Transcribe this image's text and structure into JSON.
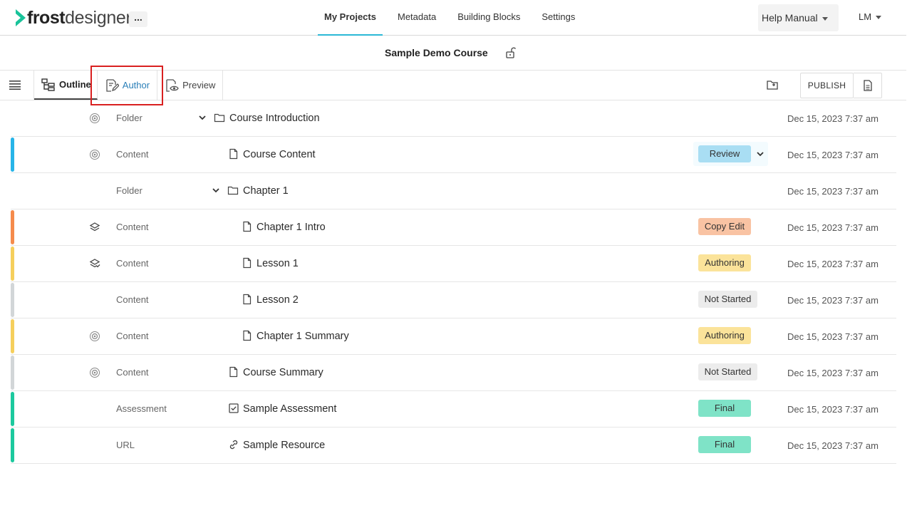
{
  "brand": {
    "name_bold": "frost",
    "name_light": "designer",
    "accent": "#19c39a"
  },
  "header": {
    "more_label": "...",
    "nav": [
      {
        "label": "My Projects",
        "active": true
      },
      {
        "label": "Metadata",
        "active": false
      },
      {
        "label": "Building Blocks",
        "active": false
      },
      {
        "label": "Settings",
        "active": false
      }
    ],
    "help_label": "Help Manual",
    "user_initials": "LM"
  },
  "course": {
    "title": "Sample Demo Course",
    "lock_icon": "unlock-icon"
  },
  "toolbar": {
    "tabs": [
      {
        "label": "Outline",
        "icon": "outline-tree-icon",
        "active": true
      },
      {
        "label": "Author",
        "icon": "author-edit-icon",
        "highlighted": true
      },
      {
        "label": "Preview",
        "icon": "preview-eye-icon"
      }
    ],
    "publish_label": "PUBLISH"
  },
  "rows": [
    {
      "type": "Folder",
      "title": "Course Introduction",
      "status_icon": "gear-icon",
      "item_icon": "folder-icon",
      "expandable": true,
      "status": "",
      "date": "Dec 15, 2023 7:37 am",
      "stripe": ""
    },
    {
      "type": "Content",
      "title": "Course Content",
      "status_icon": "gear-icon",
      "item_icon": "file-icon",
      "expandable": false,
      "status": "Review",
      "date": "Dec 15, 2023 7:37 am",
      "stripe": "#27b4e8"
    },
    {
      "type": "Folder",
      "title": "Chapter 1",
      "status_icon": "",
      "item_icon": "folder-icon",
      "expandable": true,
      "status": "",
      "date": "Dec 15, 2023 7:37 am",
      "stripe": ""
    },
    {
      "type": "Content",
      "title": "Chapter 1 Intro",
      "status_icon": "layers-icon",
      "item_icon": "file-icon",
      "expandable": false,
      "status": "Copy Edit",
      "date": "Dec 15, 2023 7:37 am",
      "stripe": "#f58b4c"
    },
    {
      "type": "Content",
      "title": "Lesson 1",
      "status_icon": "layers-check-icon",
      "item_icon": "file-icon",
      "expandable": false,
      "status": "Authoring",
      "date": "Dec 15, 2023 7:37 am",
      "stripe": "#f5cf5c"
    },
    {
      "type": "Content",
      "title": "Lesson 2",
      "status_icon": "",
      "item_icon": "file-icon",
      "expandable": false,
      "status": "Not Started",
      "date": "Dec 15, 2023 7:37 am",
      "stripe": "#d2d6d8"
    },
    {
      "type": "Content",
      "title": "Chapter 1 Summary",
      "status_icon": "gear-icon",
      "item_icon": "file-icon",
      "expandable": false,
      "status": "Authoring",
      "date": "Dec 15, 2023 7:37 am",
      "stripe": "#f5cf5c"
    },
    {
      "type": "Content",
      "title": "Course Summary",
      "status_icon": "gear-icon",
      "item_icon": "file-icon",
      "expandable": false,
      "status": "Not Started",
      "date": "Dec 15, 2023 7:37 am",
      "stripe": "#d2d6d8"
    },
    {
      "type": "Assessment",
      "title": "Sample Assessment",
      "status_icon": "",
      "item_icon": "checkbox-icon",
      "expandable": false,
      "status": "Final",
      "date": "Dec 15, 2023 7:37 am",
      "stripe": "#1cc99e"
    },
    {
      "type": "URL",
      "title": "Sample Resource",
      "status_icon": "",
      "item_icon": "link-icon",
      "expandable": false,
      "status": "Final",
      "date": "Dec 15, 2023 7:37 am",
      "stripe": "#1cc99e"
    }
  ],
  "status_colors": {
    "Review": "#a9def3",
    "Copy Edit": "#f9c3a3",
    "Authoring": "#fbe39a",
    "Not Started": "#ececec",
    "Final": "#7fe3c7"
  }
}
